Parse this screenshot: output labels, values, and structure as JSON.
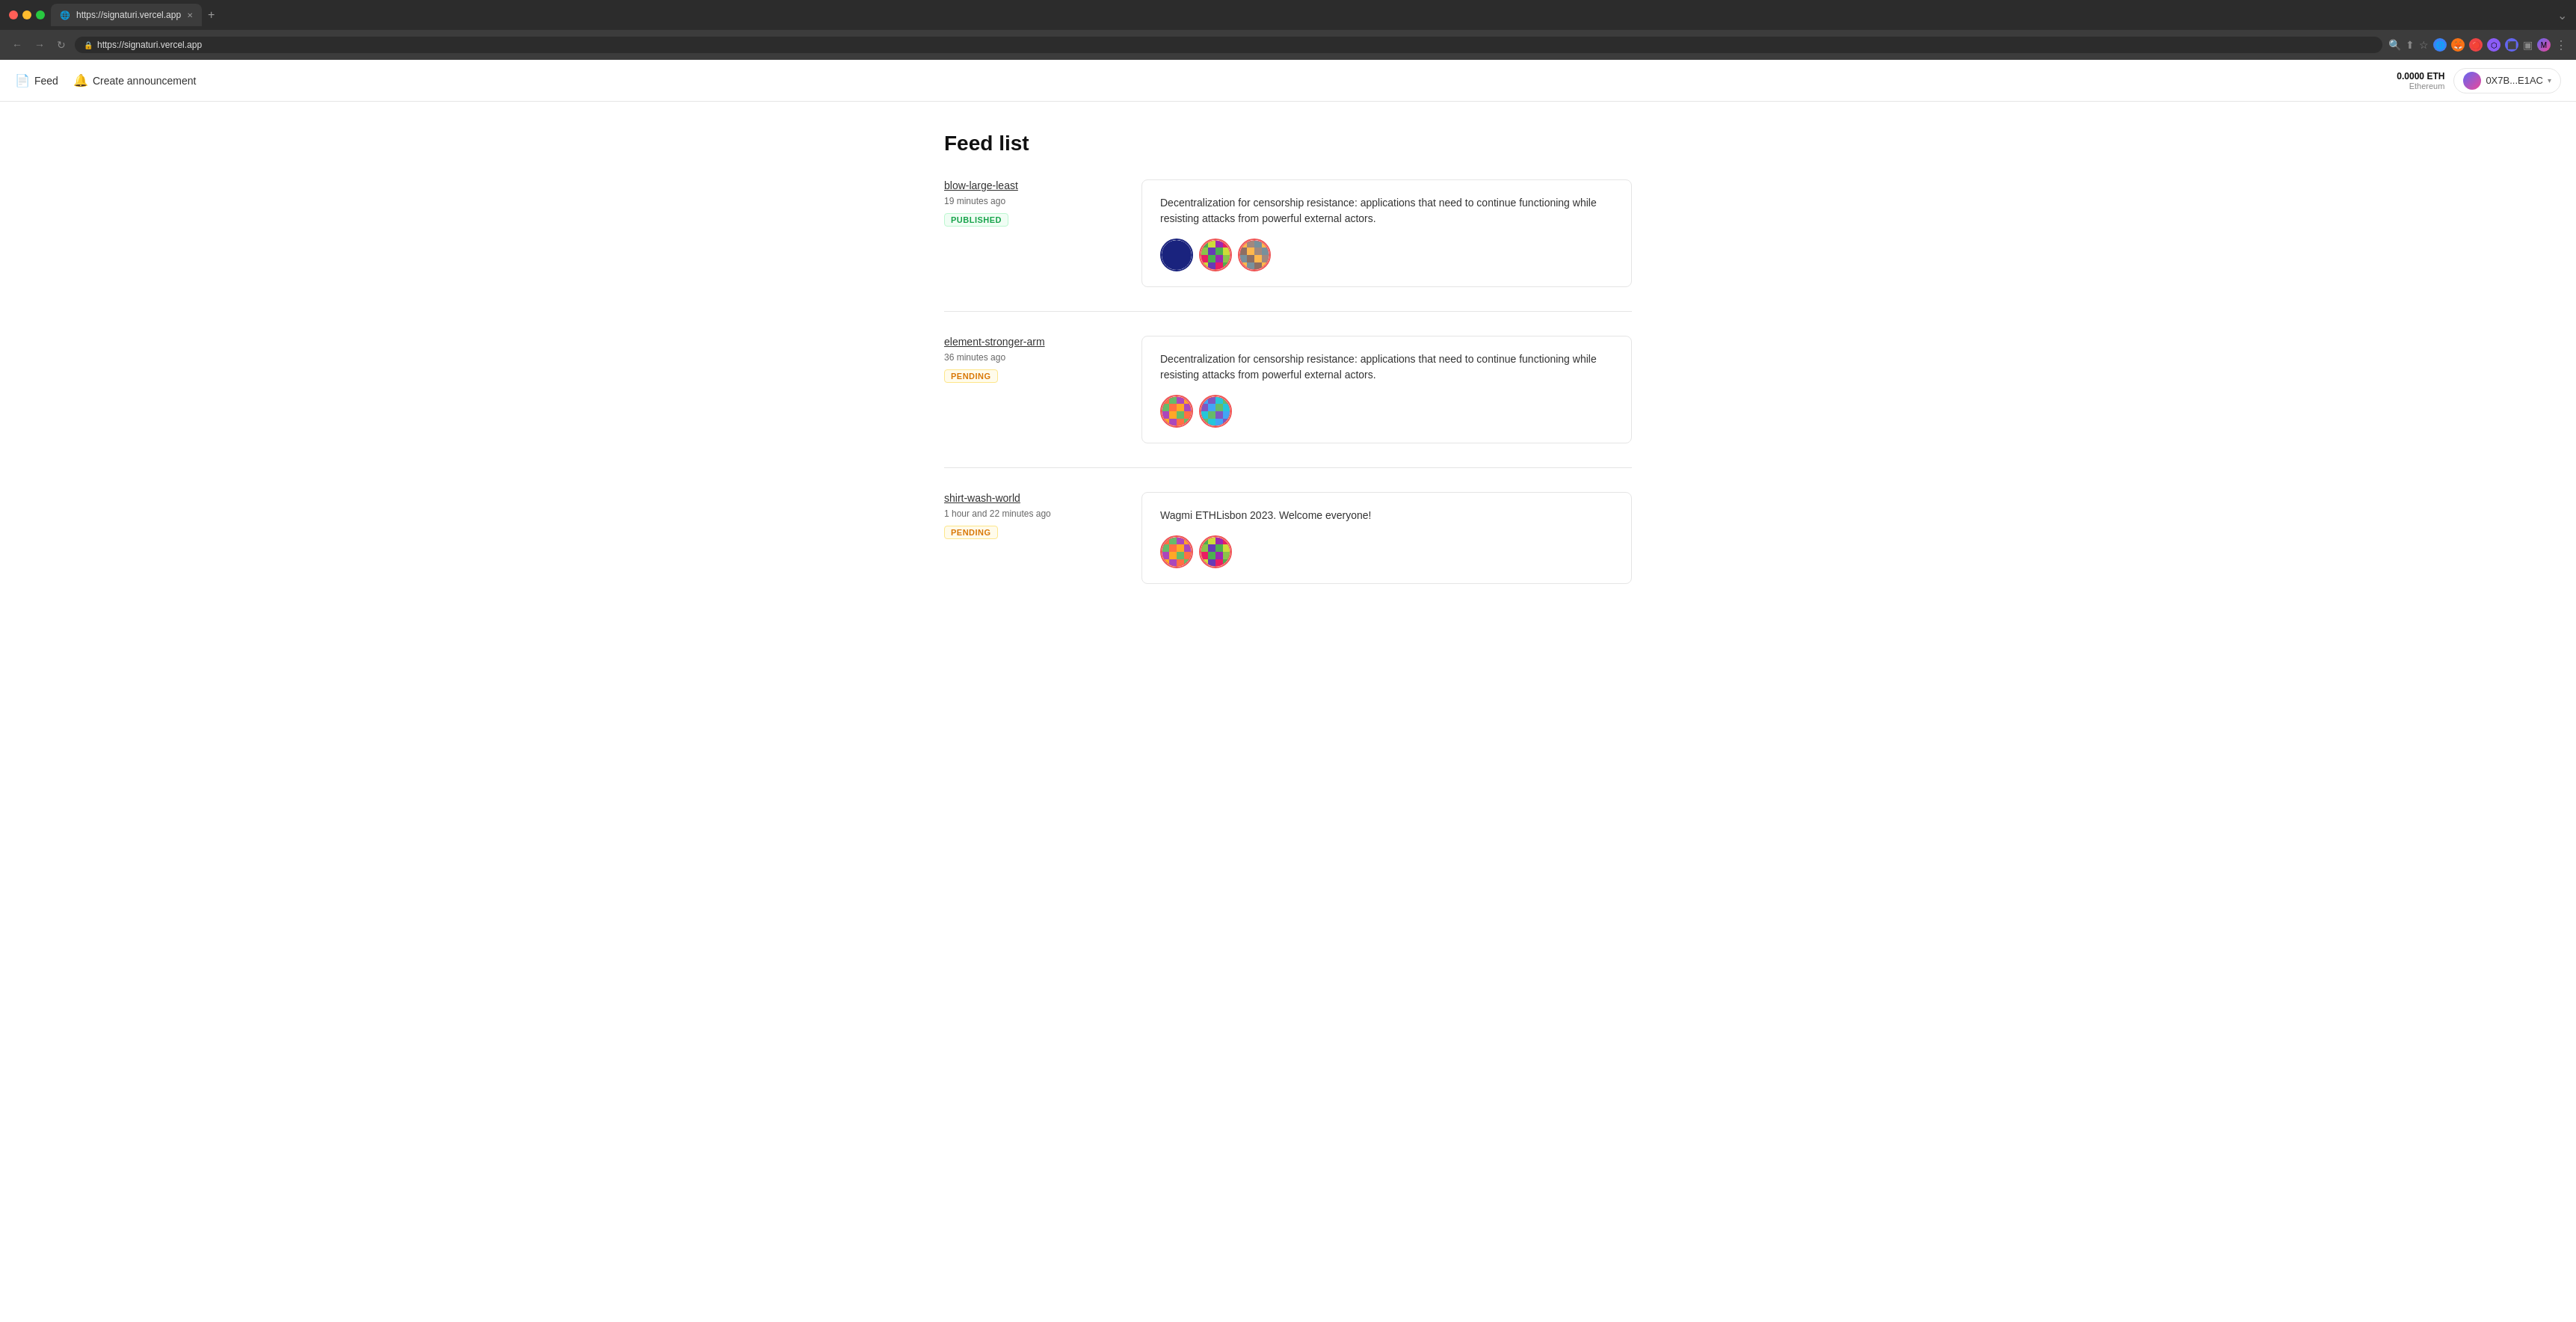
{
  "browser": {
    "url": "https://signaturi.vercel.app",
    "tab_label": "https://signaturi.vercel.app",
    "new_tab_label": "+",
    "nav_back": "←",
    "nav_forward": "→",
    "nav_refresh": "↻",
    "menu_label": "⋮"
  },
  "header": {
    "feed_label": "Feed",
    "create_announcement_label": "Create announcement",
    "eth_amount": "0.0000 ETH",
    "eth_network": "Ethereum",
    "wallet_address": "0X7B...E1AC"
  },
  "main": {
    "title": "Feed list",
    "items": [
      {
        "id": "item-1",
        "name": "blow-large-least",
        "time": "19 minutes ago",
        "status": "PUBLISHED",
        "status_type": "published",
        "message": "Decentralization for censorship resistance: applications that need to continue functioning while resisting attacks from powerful external actors.",
        "avatar_count": 3
      },
      {
        "id": "item-2",
        "name": "element-stronger-arm",
        "time": "36 minutes ago",
        "status": "PENDING",
        "status_type": "pending",
        "message": "Decentralization for censorship resistance: applications that need to continue functioning while resisting attacks from powerful external actors.",
        "avatar_count": 2
      },
      {
        "id": "item-3",
        "name": "shirt-wash-world",
        "time": "1 hour and 22 minutes ago",
        "status": "PENDING",
        "status_type": "pending",
        "message": "Wagmi ETHLisbon 2023. Welcome everyone!",
        "avatar_count": 2
      }
    ]
  }
}
